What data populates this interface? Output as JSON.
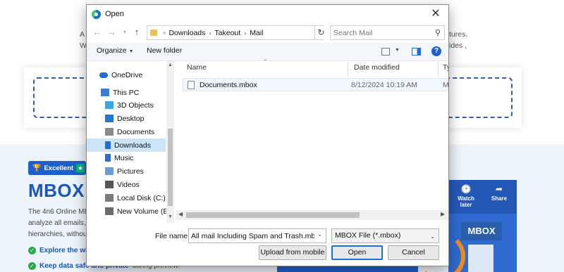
{
  "background": {
    "fragments_left": [
      "A",
      "W"
    ],
    "fragments_right": [
      "tures.",
      "ides ,"
    ],
    "badge_label": "Excellent",
    "heading": "MBOX",
    "intro_lines": [
      "The 4n6 Online MB",
      "analyze all emails, i",
      "hierarchies, without"
    ],
    "features": [
      {
        "strong": "Explore the who",
        "rest": ""
      },
      {
        "strong": "Keep data safe and private",
        "rest": " during preview."
      }
    ],
    "video_actions": [
      "Watch later",
      "Share"
    ],
    "video_label": "MBOX"
  },
  "dialog": {
    "title": "Open",
    "breadcrumb": [
      "Downloads",
      "Takeout",
      "Mail"
    ],
    "search_placeholder": "Search Mail",
    "toolbar": {
      "organize": "Organize",
      "new_folder": "New folder"
    },
    "nav_items": [
      {
        "label": "OneDrive",
        "icon": "cloud-icon",
        "indent": 18,
        "selected": false
      },
      {
        "label": "This PC",
        "icon": "pc-icon",
        "indent": 20,
        "selected": false
      },
      {
        "label": "3D Objects",
        "icon": "cube-icon",
        "indent": 26,
        "selected": false
      },
      {
        "label": "Desktop",
        "icon": "desktop-icon",
        "indent": 26,
        "selected": false
      },
      {
        "label": "Documents",
        "icon": "document-icon",
        "indent": 26,
        "selected": false
      },
      {
        "label": "Downloads",
        "icon": "download-icon",
        "indent": 26,
        "selected": true
      },
      {
        "label": "Music",
        "icon": "music-icon",
        "indent": 26,
        "selected": false
      },
      {
        "label": "Pictures",
        "icon": "picture-icon",
        "indent": 26,
        "selected": false
      },
      {
        "label": "Videos",
        "icon": "video-icon",
        "indent": 26,
        "selected": false
      },
      {
        "label": "Local Disk (C:)",
        "icon": "disk-icon",
        "indent": 26,
        "selected": false
      },
      {
        "label": "New Volume (E:)",
        "icon": "drive-icon",
        "indent": 26,
        "selected": false
      }
    ],
    "columns": [
      "Name",
      "Date modified",
      "Ty"
    ],
    "files": [
      {
        "name": "Documents.mbox",
        "date": "8/12/2024 10:19 AM",
        "type": "M"
      }
    ],
    "file_name_label": "File name:",
    "file_name_value": "All mail Including Spam and Trash.mbox",
    "file_type": "MBOX File (*.mbox)",
    "buttons": {
      "upload": "Upload from mobile",
      "open": "Open",
      "cancel": "Cancel"
    }
  }
}
